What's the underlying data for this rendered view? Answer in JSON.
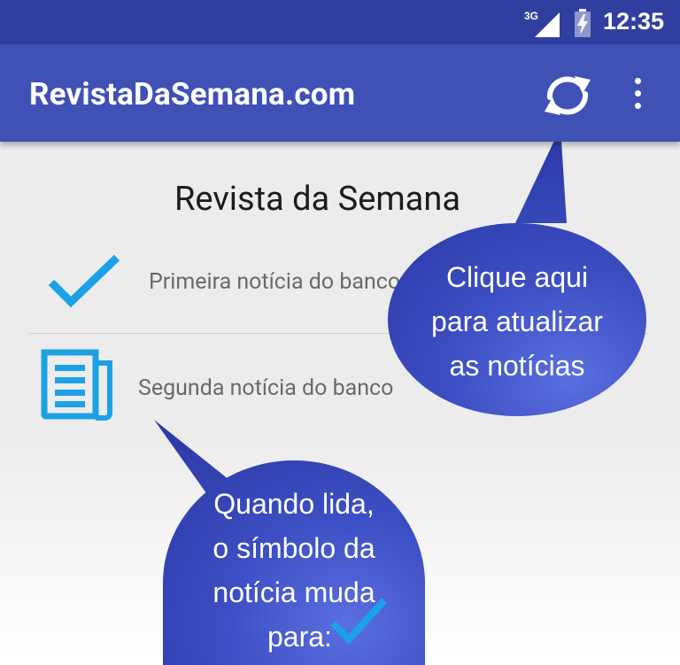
{
  "status_bar": {
    "network": "3G",
    "time": "12:35"
  },
  "app_bar": {
    "title": "RevistaDaSemana.com",
    "refresh_icon": "refresh-icon",
    "overflow_icon": "more-vert-icon"
  },
  "main": {
    "heading": "Revista da Semana",
    "news": [
      {
        "label": "Primeira notícia do banco",
        "icon": "checkmark-icon",
        "state": "read"
      },
      {
        "label": "Segunda notícia do banco",
        "icon": "newspaper-icon",
        "state": "unread"
      }
    ]
  },
  "tooltips": {
    "refresh": [
      "Clique aqui",
      "para atualizar",
      "as notícias"
    ],
    "read_state": [
      "Quando lida,",
      "o símbolo da",
      "notícia muda",
      "para:"
    ]
  },
  "colors": {
    "status_bar": "#303f9f",
    "app_bar": "#3f51b5",
    "accent_blue": "#1da1e6",
    "bubble": "#3d4fc4"
  }
}
